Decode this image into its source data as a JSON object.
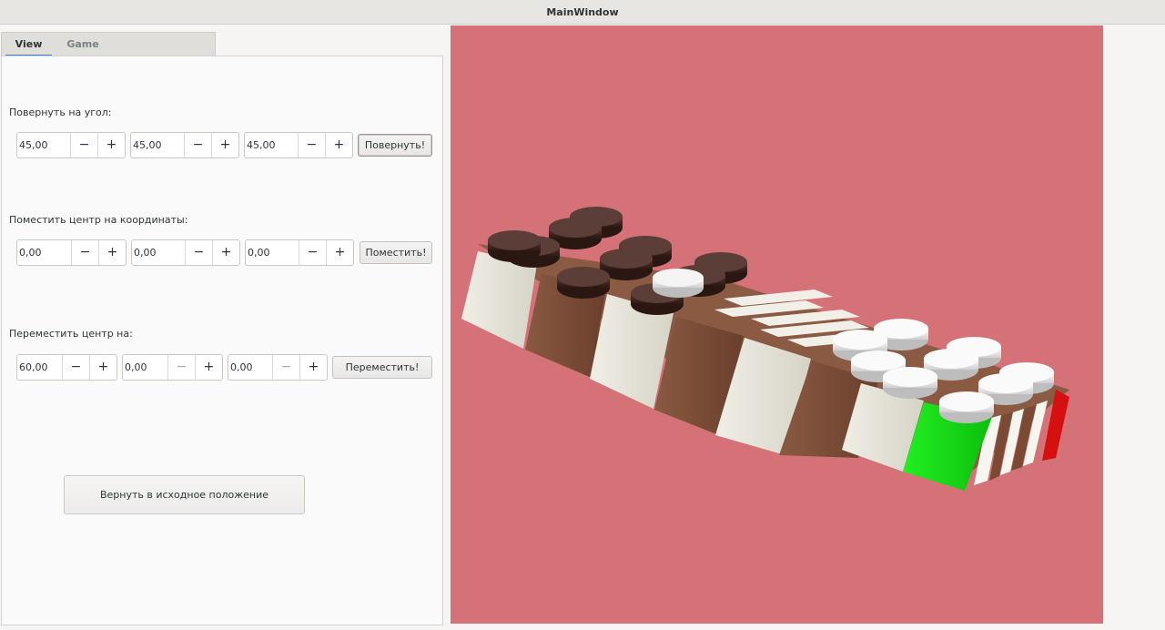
{
  "window": {
    "title": "MainWindow"
  },
  "tabs": [
    {
      "label": "View",
      "active": true
    },
    {
      "label": "Game",
      "active": false
    }
  ],
  "rotate": {
    "label": "Повернуть на угол:",
    "fields": [
      "45,00",
      "45,00",
      "45,00"
    ],
    "button": "Повернуть!"
  },
  "place": {
    "label": "Поместить центр на координаты:",
    "fields": [
      "0,00",
      "0,00",
      "0,00"
    ],
    "button": "Поместить!"
  },
  "move": {
    "label": "Переместить центр на:",
    "fields": [
      "60,00",
      "0,00",
      "0,00"
    ],
    "button": "Переместить!"
  },
  "reset": {
    "label": "Вернуть в исходное положение"
  },
  "spin_buttons": {
    "minus": "−",
    "plus": "+"
  },
  "icons": {
    "minus": "minus-icon",
    "plus": "plus-icon"
  },
  "viewport": {
    "background": "#d47277",
    "colors": {
      "light_square": "#e6e3d8",
      "dark_square": "#7a4a35",
      "highlight_square": "#12d812",
      "border": "#d60f0f",
      "dark_piece": "#3a211c",
      "light_piece": "#eeeeee"
    }
  }
}
